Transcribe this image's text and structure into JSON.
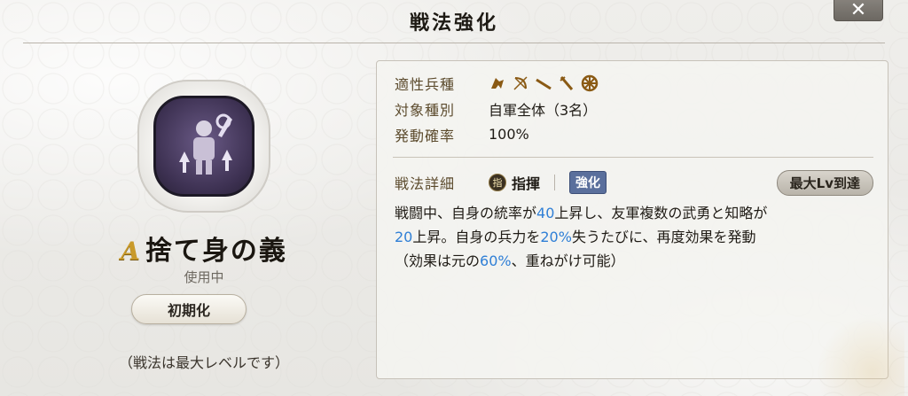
{
  "header": {
    "title": "戦法強化",
    "close_label": "✕"
  },
  "skill": {
    "grade": "A",
    "name": "捨て身の義",
    "status": "使用中",
    "reset_label": "初期化",
    "max_note": "（戦法は最大レベルです）"
  },
  "info": {
    "troop_label": "適性兵種",
    "troop_icons": [
      "cavalry-icon",
      "bow-icon",
      "spear-icon",
      "sword-icon",
      "wheel-icon"
    ],
    "target_label": "対象種別",
    "target_value": "自軍全体（3名）",
    "rate_label": "発動確率",
    "rate_value": "100%"
  },
  "detail": {
    "label": "戦法詳細",
    "cmd_badge": "指",
    "cmd_type": "指揮",
    "enhance_badge": "強化",
    "max_lv_badge": "最大Lv到達",
    "desc_parts": {
      "p1": "戦闘中、自身の統率が",
      "n1": "40",
      "p2": "上昇し、友軍複数の武勇と知略が",
      "n2": "20",
      "p3": "上昇。自身の兵力を",
      "n3": "20%",
      "p4": "失うたびに、再度効果を発動",
      "p5": "（効果は元の",
      "n4": "60%",
      "p6": "、重ねがけ可能）"
    }
  },
  "colors": {
    "accent_number": "#2f7fd6",
    "grade_gold": "#c99a2a",
    "enhance_badge": "#5a6f9c",
    "label_brown": "#5b4a2c"
  }
}
